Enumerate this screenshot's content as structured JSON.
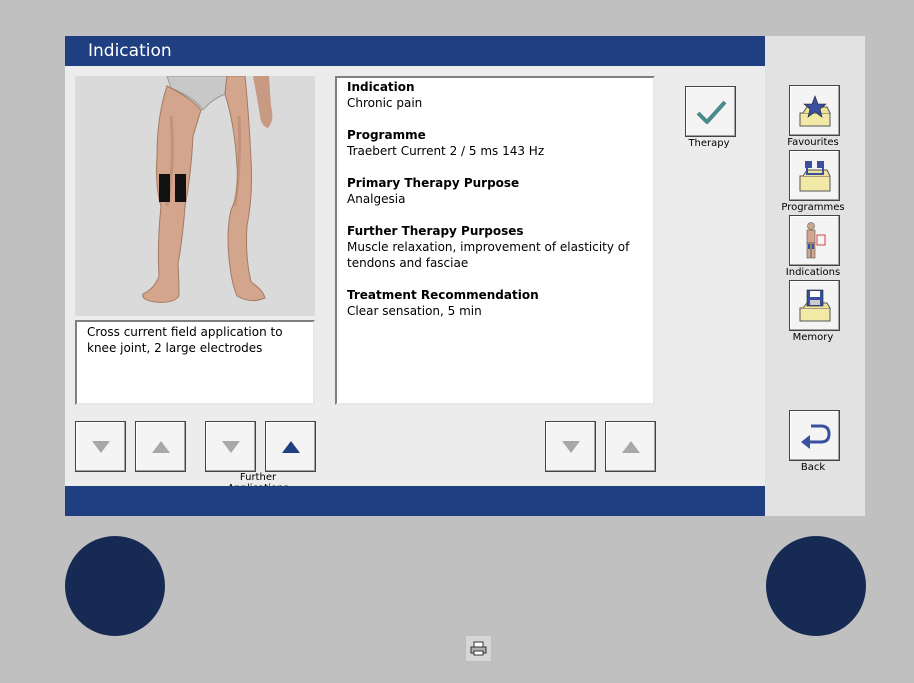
{
  "title": "Indication",
  "description": "Cross current field application to knee joint, 2 large electrodes",
  "info": [
    {
      "heading": "Indication",
      "value": "Chronic pain"
    },
    {
      "heading": "Programme",
      "value": "Traebert Current 2 / 5 ms 143 Hz"
    },
    {
      "heading": "Primary Therapy Purpose",
      "value": "Analgesia"
    },
    {
      "heading": "Further Therapy Purposes",
      "value": "Muscle relaxation, improvement of elasticity of tendons and fasciae"
    },
    {
      "heading": "Treatment Recommendation",
      "value": "Clear sensation, 5 min"
    }
  ],
  "labels": {
    "therapy": "Therapy",
    "further_applications": "Further Applications",
    "favourites": "Favourites",
    "programmes": "Programmes",
    "indications": "Indications",
    "memory": "Memory",
    "back": "Back"
  },
  "icons": {
    "therapy": "checkmark-icon",
    "favourites": "star-folder-icon",
    "programmes": "program-folder-icon",
    "indications": "person-icon",
    "memory": "floppy-folder-icon",
    "back": "back-arrow-icon",
    "print": "printer-icon"
  },
  "colors": {
    "bar": "#203f80",
    "knob": "#162a54",
    "arrow_active": "#203f80",
    "arrow_inactive": "#a8a8a8"
  }
}
